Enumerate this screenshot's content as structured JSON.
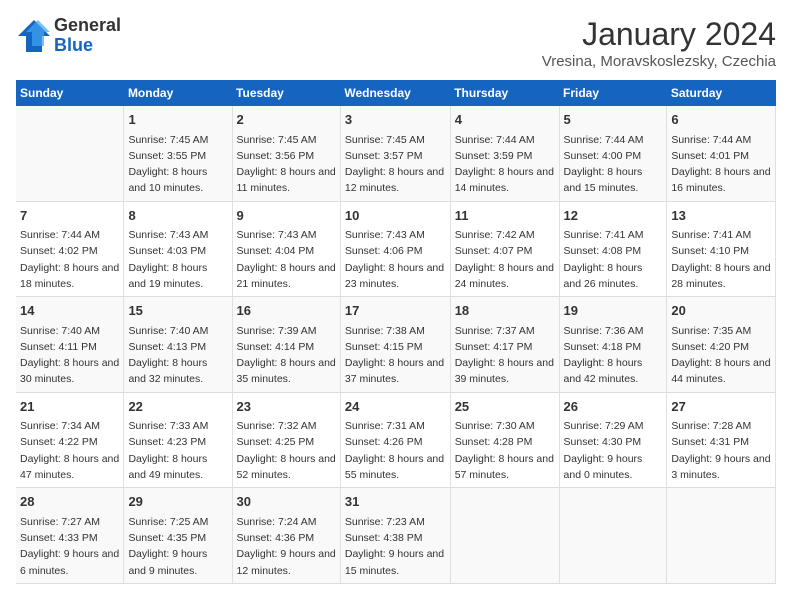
{
  "logo": {
    "general": "General",
    "blue": "Blue"
  },
  "title": "January 2024",
  "subtitle": "Vresina, Moravskoslezsky, Czechia",
  "days_header": [
    "Sunday",
    "Monday",
    "Tuesday",
    "Wednesday",
    "Thursday",
    "Friday",
    "Saturday"
  ],
  "weeks": [
    [
      {
        "day": "",
        "sunrise": "",
        "sunset": "",
        "daylight": ""
      },
      {
        "day": "1",
        "sunrise": "Sunrise: 7:45 AM",
        "sunset": "Sunset: 3:55 PM",
        "daylight": "Daylight: 8 hours and 10 minutes."
      },
      {
        "day": "2",
        "sunrise": "Sunrise: 7:45 AM",
        "sunset": "Sunset: 3:56 PM",
        "daylight": "Daylight: 8 hours and 11 minutes."
      },
      {
        "day": "3",
        "sunrise": "Sunrise: 7:45 AM",
        "sunset": "Sunset: 3:57 PM",
        "daylight": "Daylight: 8 hours and 12 minutes."
      },
      {
        "day": "4",
        "sunrise": "Sunrise: 7:44 AM",
        "sunset": "Sunset: 3:59 PM",
        "daylight": "Daylight: 8 hours and 14 minutes."
      },
      {
        "day": "5",
        "sunrise": "Sunrise: 7:44 AM",
        "sunset": "Sunset: 4:00 PM",
        "daylight": "Daylight: 8 hours and 15 minutes."
      },
      {
        "day": "6",
        "sunrise": "Sunrise: 7:44 AM",
        "sunset": "Sunset: 4:01 PM",
        "daylight": "Daylight: 8 hours and 16 minutes."
      }
    ],
    [
      {
        "day": "7",
        "sunrise": "Sunrise: 7:44 AM",
        "sunset": "Sunset: 4:02 PM",
        "daylight": "Daylight: 8 hours and 18 minutes."
      },
      {
        "day": "8",
        "sunrise": "Sunrise: 7:43 AM",
        "sunset": "Sunset: 4:03 PM",
        "daylight": "Daylight: 8 hours and 19 minutes."
      },
      {
        "day": "9",
        "sunrise": "Sunrise: 7:43 AM",
        "sunset": "Sunset: 4:04 PM",
        "daylight": "Daylight: 8 hours and 21 minutes."
      },
      {
        "day": "10",
        "sunrise": "Sunrise: 7:43 AM",
        "sunset": "Sunset: 4:06 PM",
        "daylight": "Daylight: 8 hours and 23 minutes."
      },
      {
        "day": "11",
        "sunrise": "Sunrise: 7:42 AM",
        "sunset": "Sunset: 4:07 PM",
        "daylight": "Daylight: 8 hours and 24 minutes."
      },
      {
        "day": "12",
        "sunrise": "Sunrise: 7:41 AM",
        "sunset": "Sunset: 4:08 PM",
        "daylight": "Daylight: 8 hours and 26 minutes."
      },
      {
        "day": "13",
        "sunrise": "Sunrise: 7:41 AM",
        "sunset": "Sunset: 4:10 PM",
        "daylight": "Daylight: 8 hours and 28 minutes."
      }
    ],
    [
      {
        "day": "14",
        "sunrise": "Sunrise: 7:40 AM",
        "sunset": "Sunset: 4:11 PM",
        "daylight": "Daylight: 8 hours and 30 minutes."
      },
      {
        "day": "15",
        "sunrise": "Sunrise: 7:40 AM",
        "sunset": "Sunset: 4:13 PM",
        "daylight": "Daylight: 8 hours and 32 minutes."
      },
      {
        "day": "16",
        "sunrise": "Sunrise: 7:39 AM",
        "sunset": "Sunset: 4:14 PM",
        "daylight": "Daylight: 8 hours and 35 minutes."
      },
      {
        "day": "17",
        "sunrise": "Sunrise: 7:38 AM",
        "sunset": "Sunset: 4:15 PM",
        "daylight": "Daylight: 8 hours and 37 minutes."
      },
      {
        "day": "18",
        "sunrise": "Sunrise: 7:37 AM",
        "sunset": "Sunset: 4:17 PM",
        "daylight": "Daylight: 8 hours and 39 minutes."
      },
      {
        "day": "19",
        "sunrise": "Sunrise: 7:36 AM",
        "sunset": "Sunset: 4:18 PM",
        "daylight": "Daylight: 8 hours and 42 minutes."
      },
      {
        "day": "20",
        "sunrise": "Sunrise: 7:35 AM",
        "sunset": "Sunset: 4:20 PM",
        "daylight": "Daylight: 8 hours and 44 minutes."
      }
    ],
    [
      {
        "day": "21",
        "sunrise": "Sunrise: 7:34 AM",
        "sunset": "Sunset: 4:22 PM",
        "daylight": "Daylight: 8 hours and 47 minutes."
      },
      {
        "day": "22",
        "sunrise": "Sunrise: 7:33 AM",
        "sunset": "Sunset: 4:23 PM",
        "daylight": "Daylight: 8 hours and 49 minutes."
      },
      {
        "day": "23",
        "sunrise": "Sunrise: 7:32 AM",
        "sunset": "Sunset: 4:25 PM",
        "daylight": "Daylight: 8 hours and 52 minutes."
      },
      {
        "day": "24",
        "sunrise": "Sunrise: 7:31 AM",
        "sunset": "Sunset: 4:26 PM",
        "daylight": "Daylight: 8 hours and 55 minutes."
      },
      {
        "day": "25",
        "sunrise": "Sunrise: 7:30 AM",
        "sunset": "Sunset: 4:28 PM",
        "daylight": "Daylight: 8 hours and 57 minutes."
      },
      {
        "day": "26",
        "sunrise": "Sunrise: 7:29 AM",
        "sunset": "Sunset: 4:30 PM",
        "daylight": "Daylight: 9 hours and 0 minutes."
      },
      {
        "day": "27",
        "sunrise": "Sunrise: 7:28 AM",
        "sunset": "Sunset: 4:31 PM",
        "daylight": "Daylight: 9 hours and 3 minutes."
      }
    ],
    [
      {
        "day": "28",
        "sunrise": "Sunrise: 7:27 AM",
        "sunset": "Sunset: 4:33 PM",
        "daylight": "Daylight: 9 hours and 6 minutes."
      },
      {
        "day": "29",
        "sunrise": "Sunrise: 7:25 AM",
        "sunset": "Sunset: 4:35 PM",
        "daylight": "Daylight: 9 hours and 9 minutes."
      },
      {
        "day": "30",
        "sunrise": "Sunrise: 7:24 AM",
        "sunset": "Sunset: 4:36 PM",
        "daylight": "Daylight: 9 hours and 12 minutes."
      },
      {
        "day": "31",
        "sunrise": "Sunrise: 7:23 AM",
        "sunset": "Sunset: 4:38 PM",
        "daylight": "Daylight: 9 hours and 15 minutes."
      },
      {
        "day": "",
        "sunrise": "",
        "sunset": "",
        "daylight": ""
      },
      {
        "day": "",
        "sunrise": "",
        "sunset": "",
        "daylight": ""
      },
      {
        "day": "",
        "sunrise": "",
        "sunset": "",
        "daylight": ""
      }
    ]
  ]
}
